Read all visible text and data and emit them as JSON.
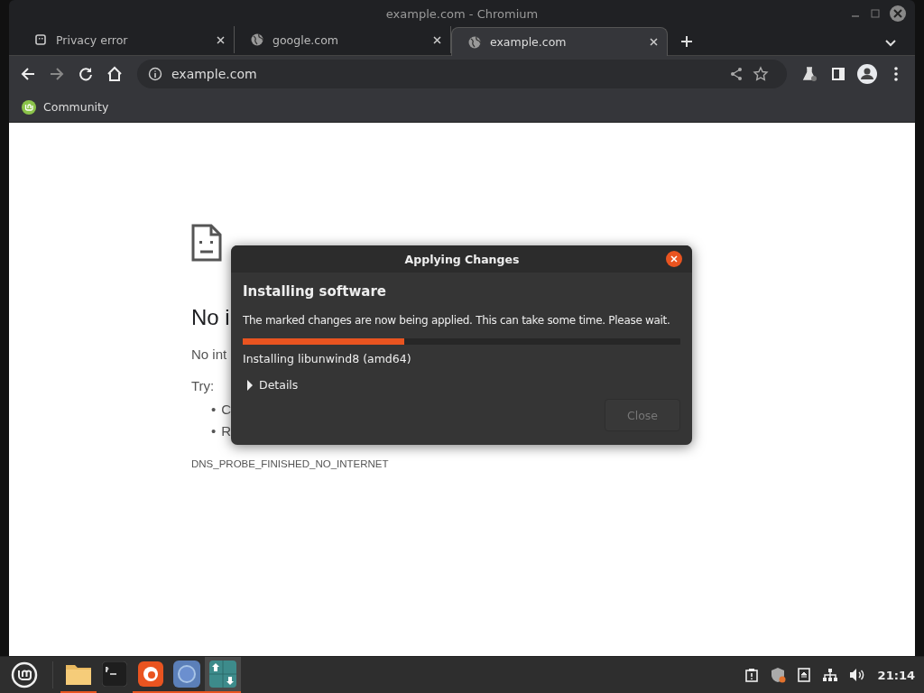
{
  "window": {
    "title": "example.com - Chromium"
  },
  "tabs": [
    {
      "label": "Privacy error",
      "selected": false
    },
    {
      "label": "google.com",
      "selected": false
    },
    {
      "label": "example.com",
      "selected": true
    }
  ],
  "address_bar": {
    "value": "example.com"
  },
  "bookmarks": [
    {
      "label": "Community"
    }
  ],
  "page": {
    "heading": "No i",
    "message": "No int",
    "try_label": "Try:",
    "suggestions": [
      {
        "bullet": "•",
        "text": "C"
      },
      {
        "bullet": "•",
        "text": "R"
      }
    ],
    "error_code": "DNS_PROBE_FINISHED_NO_INTERNET"
  },
  "dialog": {
    "title": "Applying Changes",
    "heading": "Installing software",
    "message": "The marked changes are now being applied. This can take some time. Please wait.",
    "progress": {
      "level": 0.37
    },
    "status": "Installing libunwind8 (amd64)",
    "details": {
      "label": "Details",
      "expanded": false
    },
    "button": {
      "label": "Close",
      "disabled": true
    }
  },
  "taskbar": {
    "apps": [
      {
        "kind": "files",
        "running": true,
        "selected": false
      },
      {
        "kind": "terminal",
        "running": false,
        "selected": false
      },
      {
        "kind": "firefox",
        "running": true,
        "selected": false
      },
      {
        "kind": "chromium",
        "running": true,
        "selected": false
      },
      {
        "kind": "updates",
        "running": true,
        "selected": true
      }
    ],
    "clock": "21:14"
  }
}
